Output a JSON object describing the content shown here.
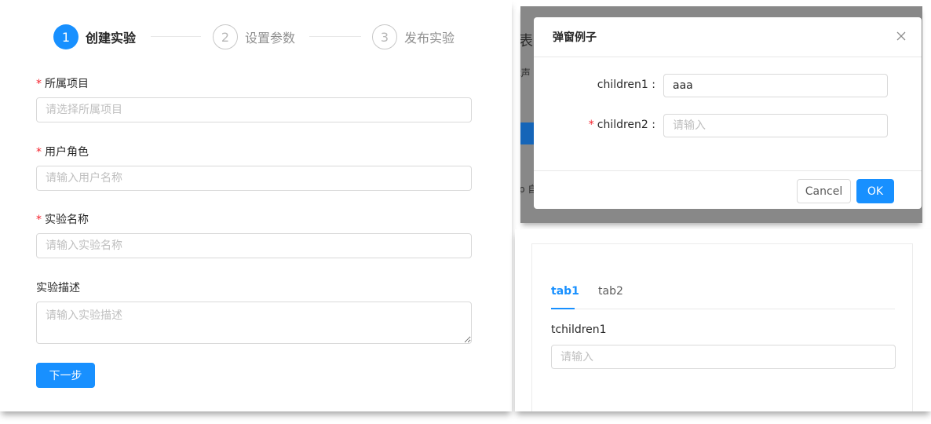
{
  "left_form": {
    "steps": [
      {
        "number": "1",
        "title": "创建实验"
      },
      {
        "number": "2",
        "title": "设置参数"
      },
      {
        "number": "3",
        "title": "发布实验"
      }
    ],
    "required_mark": "*",
    "fields": {
      "project": {
        "label": "所属项目",
        "placeholder": "请选择所属项目"
      },
      "role": {
        "label": "用户角色",
        "placeholder": "请输入用户名称"
      },
      "name": {
        "label": "实验名称",
        "placeholder": "请输入实验名称"
      },
      "desc": {
        "label": "实验描述",
        "placeholder": "请输入实验描述"
      }
    },
    "next_button": "下一步"
  },
  "modal_panel": {
    "background_fragments": {
      "title": "表",
      "subtitle": "t声",
      "bottom": "p 自"
    },
    "modal": {
      "title": "弹窗例子",
      "close_icon": "close-icon",
      "required_mark": "*",
      "field1": {
        "label": "children1 :",
        "value": "aaa"
      },
      "field2": {
        "label": "children2 :",
        "placeholder": "请输入"
      },
      "cancel_button": "Cancel",
      "ok_button": "OK"
    }
  },
  "tabs_panel": {
    "tabs": [
      {
        "label": "tab1",
        "active": true
      },
      {
        "label": "tab2",
        "active": false
      }
    ],
    "field": {
      "label": "tchildren1",
      "placeholder": "请输入"
    }
  },
  "colors": {
    "primary": "#1890ff",
    "required": "#f5222d",
    "overlay": "#888888"
  }
}
